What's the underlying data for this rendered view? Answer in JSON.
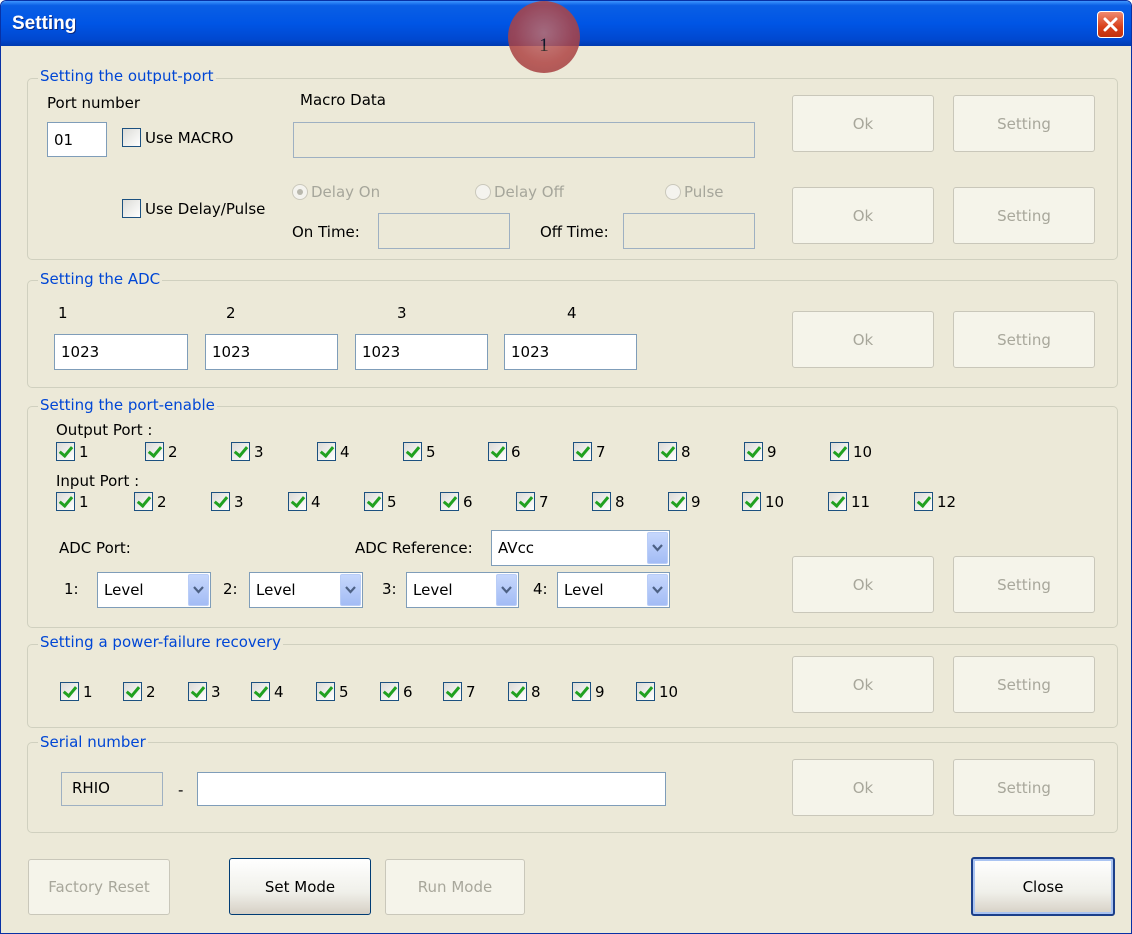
{
  "window": {
    "title": "Setting"
  },
  "annotation": {
    "label": "1"
  },
  "output_port": {
    "legend": "Setting the output-port",
    "port_number_label": "Port number",
    "port_number_value": "01",
    "use_macro_label": "Use MACRO",
    "macro_data_label": "Macro Data",
    "macro_data_value": "",
    "use_delay_label": "Use Delay/Pulse",
    "radio_delay_on": "Delay On",
    "radio_delay_off": "Delay Off",
    "radio_pulse": "Pulse",
    "on_time_label": "On Time:",
    "off_time_label": "Off Time:",
    "on_time_value": "",
    "off_time_value": "",
    "ok1": "Ok",
    "setting1": "Setting",
    "ok2": "Ok",
    "setting2": "Setting"
  },
  "adc": {
    "legend": "Setting the ADC",
    "labels": [
      "1",
      "2",
      "3",
      "4"
    ],
    "values": [
      "1023",
      "1023",
      "1023",
      "1023"
    ],
    "ok": "Ok",
    "setting": "Setting"
  },
  "port_enable": {
    "legend": "Setting the port-enable",
    "output_label": "Output Port :",
    "output_ports": [
      "1",
      "2",
      "3",
      "4",
      "5",
      "6",
      "7",
      "8",
      "9",
      "10"
    ],
    "input_label": "Input Port :",
    "input_ports": [
      "1",
      "2",
      "3",
      "4",
      "5",
      "6",
      "7",
      "8",
      "9",
      "10",
      "11",
      "12"
    ],
    "adc_port_label": "ADC Port:",
    "adc_reference_label": "ADC Reference:",
    "adc_reference_value": "AVcc",
    "adc_modes": [
      {
        "label": "1:",
        "value": "Level"
      },
      {
        "label": "2:",
        "value": "Level"
      },
      {
        "label": "3:",
        "value": "Level"
      },
      {
        "label": "4:",
        "value": "Level"
      }
    ],
    "ok": "Ok",
    "setting": "Setting"
  },
  "power_failure": {
    "legend": "Setting a power-failure recovery",
    "ports": [
      "1",
      "2",
      "3",
      "4",
      "5",
      "6",
      "7",
      "8",
      "9",
      "10"
    ],
    "ok": "Ok",
    "setting": "Setting"
  },
  "serial": {
    "legend": "Serial number",
    "prefix": "RHIO",
    "dash": "-",
    "value": "",
    "ok": "Ok",
    "setting": "Setting"
  },
  "footer": {
    "factory_reset": "Factory Reset",
    "set_mode": "Set Mode",
    "run_mode": "Run Mode",
    "close": "Close"
  }
}
